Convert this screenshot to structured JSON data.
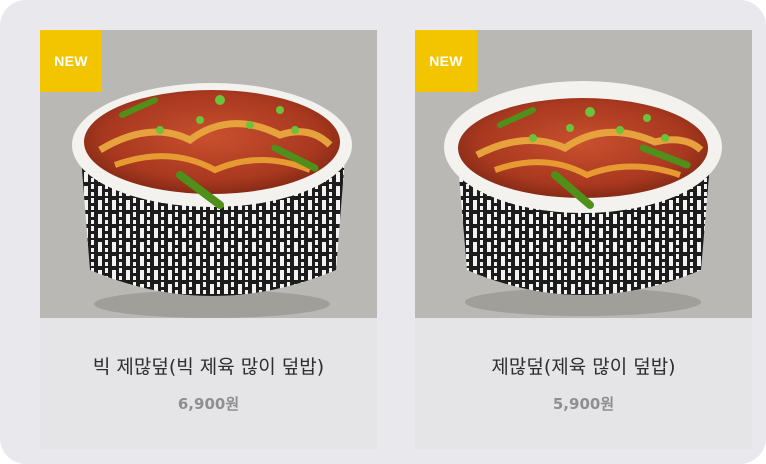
{
  "products": [
    {
      "badge": "NEW",
      "name": "빅 제많덮(빅 제육 많이 덮밥)",
      "price": "6,900원",
      "image_icon": "spicy-pork-rice-bowl-large"
    },
    {
      "badge": "NEW",
      "name": "제많덮(제육 많이 덮밥)",
      "price": "5,900원",
      "image_icon": "spicy-pork-rice-bowl"
    }
  ],
  "colors": {
    "badge": "#f2c500",
    "photo_background": "#b9b8b5",
    "card_background": "#e5e5e7",
    "page_background": "#e9e8ec"
  }
}
